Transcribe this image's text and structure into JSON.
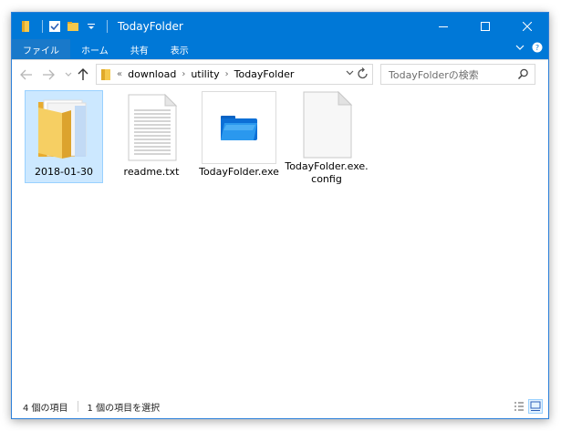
{
  "window": {
    "title": "TodayFolder"
  },
  "ribbon": {
    "tabs": [
      {
        "label": "ファイル",
        "active": true
      },
      {
        "label": "ホーム"
      },
      {
        "label": "共有"
      },
      {
        "label": "表示"
      }
    ]
  },
  "nav": {
    "breadcrumbs": [
      "download",
      "utility",
      "TodayFolder"
    ],
    "overflow": "«",
    "separator": "›"
  },
  "search": {
    "placeholder": "TodayFolderの検索"
  },
  "files": [
    {
      "name": "2018-01-30",
      "icon": "folder-icon",
      "selected": true
    },
    {
      "name": "readme.txt",
      "icon": "text-file-icon"
    },
    {
      "name": "TodayFolder.exe",
      "icon": "app-folder-icon"
    },
    {
      "name": "TodayFolder.exe.config",
      "icon": "blank-file-icon"
    }
  ],
  "status": {
    "item_count": "4 個の項目",
    "selection": "1 個の項目を選択"
  },
  "colors": {
    "accent": "#0078d7",
    "selection": "#cce8ff"
  }
}
